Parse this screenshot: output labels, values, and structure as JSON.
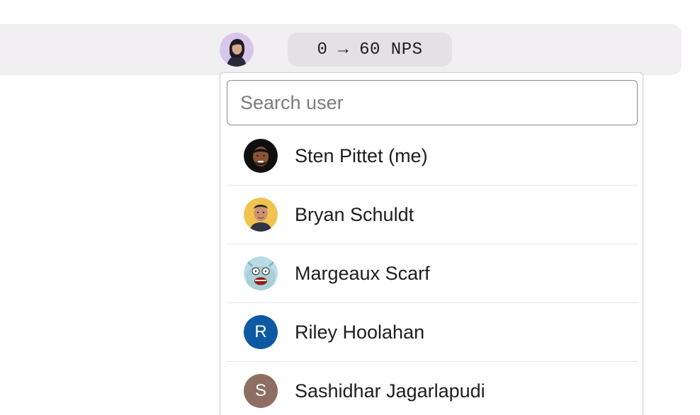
{
  "header": {
    "goal_label": "0 → 60 NPS",
    "owner_avatar_icon": "user-photo-avatar"
  },
  "user_picker": {
    "search_placeholder": "Search user",
    "search_value": "",
    "users": [
      {
        "name": "Sten Pittet (me)",
        "avatar_type": "photo"
      },
      {
        "name": "Bryan Schuldt",
        "avatar_type": "photo"
      },
      {
        "name": "Margeaux Scarf",
        "avatar_type": "photo"
      },
      {
        "name": "Riley Hoolahan",
        "avatar_type": "initial",
        "initial": "R",
        "color": "#0d5aa3"
      },
      {
        "name": "Sashidhar Jagarlapudi",
        "avatar_type": "initial",
        "initial": "S",
        "color": "#8e6e62"
      }
    ]
  },
  "colors": {
    "topbar_bg": "#f1eff2",
    "pill_bg": "#e3e1e4",
    "text": "#1d1d1f"
  }
}
